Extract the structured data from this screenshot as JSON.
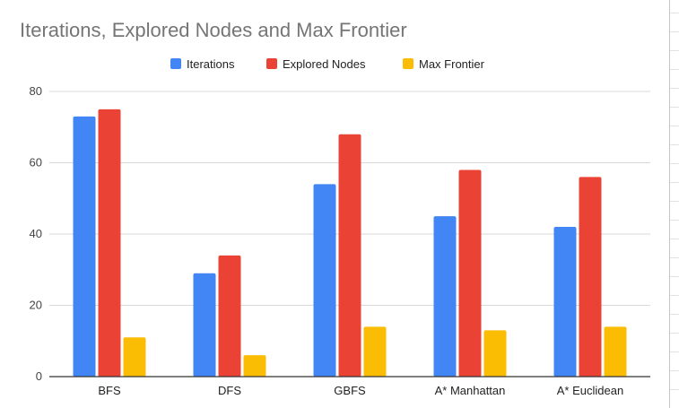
{
  "chart_data": {
    "type": "bar",
    "title": "Iterations, Explored Nodes and Max Frontier",
    "categories": [
      "BFS",
      "DFS",
      "GBFS",
      "A* Manhattan",
      "A* Euclidean"
    ],
    "series": [
      {
        "name": "Iterations",
        "color": "#4285f4",
        "values": [
          73,
          29,
          54,
          45,
          42
        ]
      },
      {
        "name": "Explored Nodes",
        "color": "#ea4335",
        "values": [
          75,
          34,
          68,
          58,
          56
        ]
      },
      {
        "name": "Max Frontier",
        "color": "#fbbc04",
        "values": [
          11,
          6,
          14,
          13,
          14
        ]
      }
    ],
    "ylim": [
      0,
      80
    ],
    "yticks": [
      0,
      20,
      40,
      60,
      80
    ],
    "grid": true,
    "legend_position": "top-center",
    "xlabel": "",
    "ylabel": ""
  }
}
